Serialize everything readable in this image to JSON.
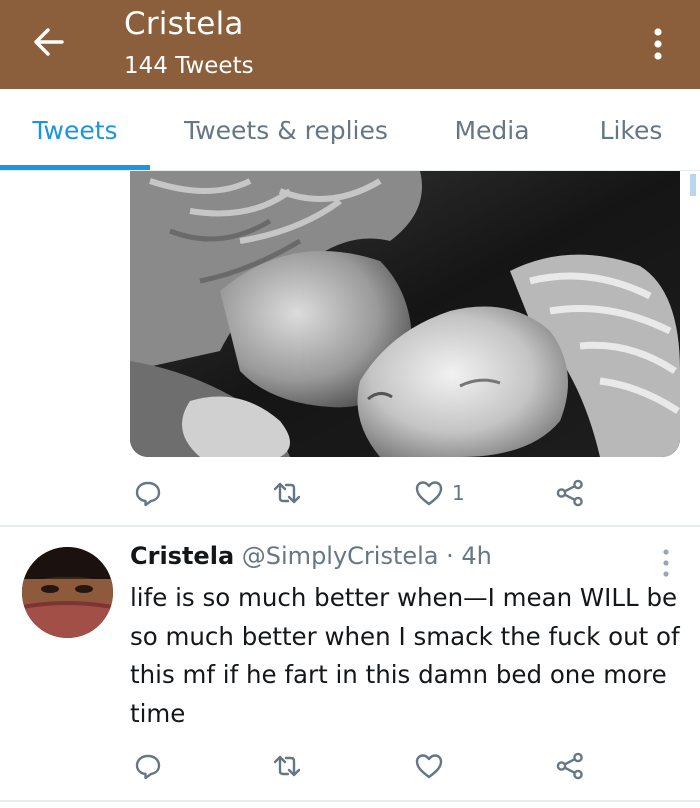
{
  "header": {
    "title": "Cristela",
    "subtitle": "144 Tweets",
    "background_color": "#8b5e3c",
    "back_icon": "arrow-left-icon",
    "more_icon": "more-vertical-icon"
  },
  "tabs": [
    {
      "label": "Tweets",
      "active": true
    },
    {
      "label": "Tweets & replies",
      "active": false
    },
    {
      "label": "Media",
      "active": false
    },
    {
      "label": "Likes",
      "active": false
    }
  ],
  "accent_color": "#1b95e0",
  "first_tweet": {
    "media_description_icon": "image",
    "actions": {
      "reply_icon": "reply-icon",
      "retweet_icon": "retweet-icon",
      "like_icon": "heart-icon",
      "like_count": "1",
      "share_icon": "share-icon"
    }
  },
  "second_tweet": {
    "name": "Cristela",
    "handle": "@SimplyCristela",
    "time": "· 4h",
    "text": "life is so much better when—I mean WILL be so much better when I smack the fuck out of this mf if he fart in this damn bed one more time",
    "actions": {
      "reply_icon": "reply-icon",
      "retweet_icon": "retweet-icon",
      "like_icon": "heart-icon",
      "share_icon": "share-icon"
    }
  }
}
